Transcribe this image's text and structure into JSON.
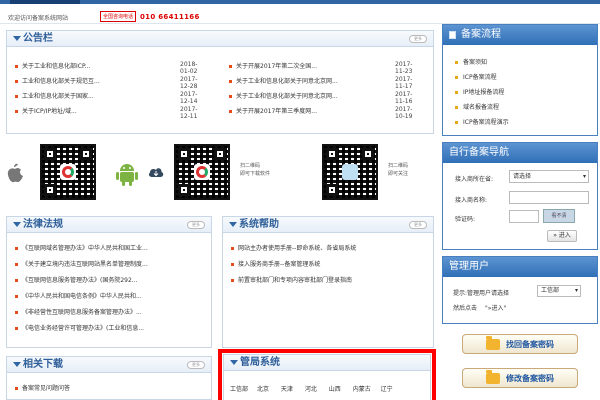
{
  "topbar": {
    "welcome": "欢迎访问备案系统网站",
    "hotline_label": "全国咨询电话",
    "hotline": "010 66411166"
  },
  "announcements": {
    "title": "公告栏",
    "more": "更多",
    "left": [
      {
        "text": "关于工业和信息化部ICP...",
        "date": "2018-01-02"
      },
      {
        "text": "工业和信息化部关于规范互...",
        "date": "2017-12-28"
      },
      {
        "text": "工业和信息化部关于国家...",
        "date": "2017-12-14"
      },
      {
        "text": "关于ICP/IP地址/域...",
        "date": "2017-12-11"
      }
    ],
    "right": [
      {
        "text": "关于开展2017年第二次全国...",
        "date": "2017-11-23"
      },
      {
        "text": "关于工业和信息化部关于同意北京网...",
        "date": "2017-11-17"
      },
      {
        "text": "关于工业和信息化部关于同意北京网...",
        "date": "2017-11-16"
      },
      {
        "text": "关于开展2017年第三季度网...",
        "date": "2017-10-19"
      }
    ]
  },
  "apps": {
    "caption1": "扫二维码\n即可下载软件",
    "caption2": "扫二维码\n即可关注"
  },
  "laws": {
    "title": "法律法规",
    "more": "更多",
    "items": [
      "《互联网域名管理办法》中华人民共和国工业...",
      "《关于建立境内违法互联网站黑名单管理制度...",
      "《互联网信息服务管理办法》(国务院292...",
      "《中华人民共和国电信条例》中华人民共和...",
      "《非经营性互联网信息服务备案管理办法》...",
      "《电信业务经营许可管理办法》(工业和信息..."
    ]
  },
  "help": {
    "title": "系统帮助",
    "more": "更多",
    "items": [
      "网站主办者使用手册--即命系统、各省局系统",
      "接入服务商手册--备案管理系统",
      "前置审批部门和专项内容审批部门登录指南"
    ]
  },
  "downloads": {
    "title": "相关下载",
    "more": "更多",
    "items": [
      "备案常见问题问答"
    ]
  },
  "bureau": {
    "title": "管局系统",
    "items": [
      "工信部",
      "北京",
      "天津",
      "河北",
      "山西",
      "内蒙古",
      "辽宁"
    ]
  },
  "flow": {
    "title": "备案流程",
    "items": [
      "备案须知",
      "ICP备案流程",
      "IP地址报备流程",
      "域名报备流程",
      "ICP备案流程演示"
    ]
  },
  "nav": {
    "title": "自行备案导航",
    "province_label": "接入商所在省:",
    "province_value": "请选择",
    "name_label": "接入商名称:",
    "code_label": "验证码:",
    "refresh": "看不清",
    "enter": "进入"
  },
  "admin": {
    "title": "管理用户",
    "hint": "提示:管理用户请选择",
    "select": "工信部",
    "hint2": "然后点击",
    "enter": "进入"
  },
  "buttons": {
    "find_password": "找回备案密码",
    "change_password": "修改备案密码"
  },
  "colors": {
    "highlight": "#ff0000",
    "accent": "#2f66a3"
  }
}
